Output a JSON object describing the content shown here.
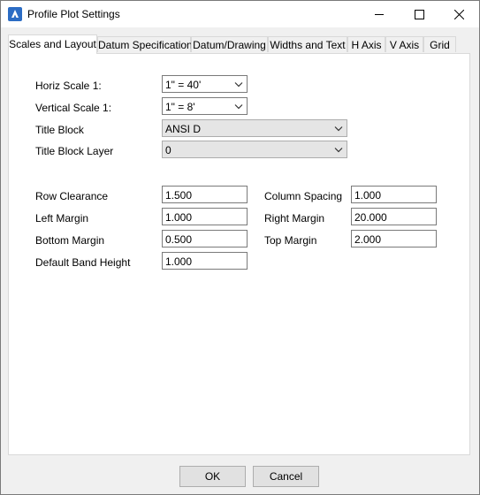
{
  "window": {
    "title": "Profile Plot Settings"
  },
  "tabs": [
    {
      "label": "Scales and Layout"
    },
    {
      "label": "Datum Specification"
    },
    {
      "label": "Datum/Drawing"
    },
    {
      "label": "Widths and Text"
    },
    {
      "label": "H Axis"
    },
    {
      "label": "V Axis"
    },
    {
      "label": "Grid"
    }
  ],
  "form": {
    "horiz_scale": {
      "label": "Horiz Scale 1:",
      "value": "1\" = 40'"
    },
    "vert_scale": {
      "label": "Vertical Scale 1:",
      "value": "1\" = 8'"
    },
    "title_block": {
      "label": "Title Block",
      "value": "ANSI D"
    },
    "title_block_layer": {
      "label": "Title Block Layer",
      "value": "0"
    },
    "row_clearance": {
      "label": "Row Clearance",
      "value": "1.500"
    },
    "left_margin": {
      "label": "Left Margin",
      "value": "1.000"
    },
    "bottom_margin": {
      "label": "Bottom Margin",
      "value": "0.500"
    },
    "default_band_height": {
      "label": "Default Band Height",
      "value": "1.000"
    },
    "column_spacing": {
      "label": "Column Spacing",
      "value": "1.000"
    },
    "right_margin": {
      "label": "Right Margin",
      "value": "20.000"
    },
    "top_margin": {
      "label": "Top Margin",
      "value": "2.000"
    }
  },
  "buttons": {
    "ok": "OK",
    "cancel": "Cancel"
  },
  "colors": {
    "brand": "#2b6cc4",
    "window_bg": "#f0f0f0",
    "panel_bg": "#ffffff"
  }
}
